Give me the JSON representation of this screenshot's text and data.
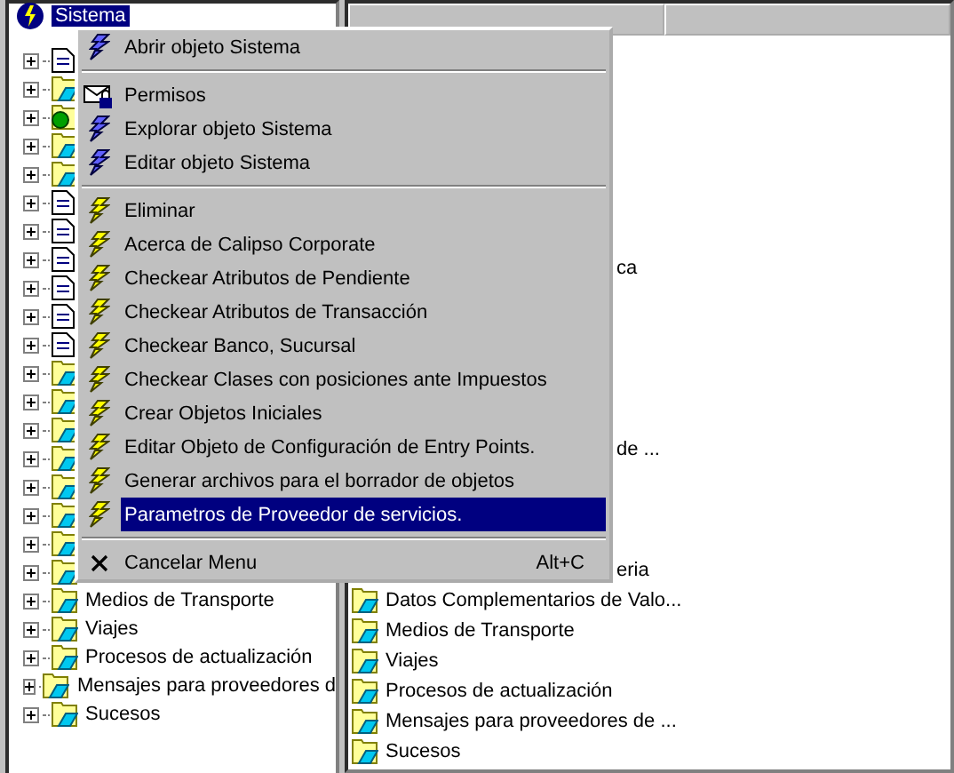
{
  "tree": {
    "root": {
      "label": "Sistema",
      "selected": true
    },
    "items": [
      {
        "kind": "document"
      },
      {
        "kind": "folder"
      },
      {
        "kind": "globe"
      },
      {
        "kind": "folder"
      },
      {
        "kind": "folder"
      },
      {
        "kind": "document"
      },
      {
        "kind": "document"
      },
      {
        "kind": "document"
      },
      {
        "kind": "document"
      },
      {
        "kind": "document"
      },
      {
        "kind": "document"
      },
      {
        "kind": "folder"
      },
      {
        "kind": "folder"
      },
      {
        "kind": "folder"
      },
      {
        "kind": "folder"
      },
      {
        "kind": "folder"
      },
      {
        "kind": "folder"
      },
      {
        "kind": "folder"
      },
      {
        "kind": "folder"
      },
      {
        "kind": "folder",
        "label": "Medios de Transporte"
      },
      {
        "kind": "folder",
        "label": "Viajes"
      },
      {
        "kind": "folder",
        "label": "Procesos de actualización"
      },
      {
        "kind": "folder",
        "label": "Mensajes para proveedores d"
      },
      {
        "kind": "folder",
        "label": "Sucesos"
      }
    ]
  },
  "list": {
    "rows": [
      {
        "kind": "fragment",
        "label": "ca"
      },
      {
        "kind": "fragment",
        "label": "de ..."
      },
      {
        "kind": "fragment",
        "label": "eria"
      },
      {
        "kind": "folder",
        "label": "Datos Complementarios de Valo..."
      },
      {
        "kind": "folder",
        "label": "Medios de Transporte"
      },
      {
        "kind": "folder",
        "label": "Viajes"
      },
      {
        "kind": "folder",
        "label": "Procesos de actualización"
      },
      {
        "kind": "folder",
        "label": "Mensajes para proveedores de ..."
      },
      {
        "kind": "folder",
        "label": "Sucesos"
      }
    ]
  },
  "context_menu": [
    {
      "kind": "blue-bolt",
      "label": "Abrir objeto Sistema",
      "selected": false
    },
    {
      "kind": "separator"
    },
    {
      "kind": "permissions",
      "label": "Permisos",
      "selected": false
    },
    {
      "kind": "blue-bolt",
      "label": "Explorar objeto Sistema",
      "selected": false
    },
    {
      "kind": "blue-bolt",
      "label": "Editar objeto Sistema",
      "selected": false
    },
    {
      "kind": "separator"
    },
    {
      "kind": "yellow-bolt",
      "label": "Eliminar",
      "selected": false
    },
    {
      "kind": "yellow-bolt",
      "label": "Acerca de Calipso Corporate",
      "selected": false
    },
    {
      "kind": "yellow-bolt",
      "label": "Checkear Atributos de Pendiente",
      "selected": false
    },
    {
      "kind": "yellow-bolt",
      "label": "Checkear Atributos de Transacción",
      "selected": false
    },
    {
      "kind": "yellow-bolt",
      "label": "Checkear Banco, Sucursal",
      "selected": false
    },
    {
      "kind": "yellow-bolt",
      "label": "Checkear Clases con posiciones ante Impuestos",
      "selected": false
    },
    {
      "kind": "yellow-bolt",
      "label": "Crear Objetos Iniciales",
      "selected": false
    },
    {
      "kind": "yellow-bolt",
      "label": "Editar Objeto de Configuración de Entry Points.",
      "selected": false
    },
    {
      "kind": "yellow-bolt",
      "label": "Generar archivos para el borrador de objetos",
      "selected": false
    },
    {
      "kind": "yellow-bolt",
      "label": "Parametros de Proveedor de servicios.",
      "selected": true
    },
    {
      "kind": "separator"
    },
    {
      "kind": "cancel",
      "label": "Cancelar Menu",
      "shortcut": "Alt+C",
      "selected": false
    }
  ]
}
